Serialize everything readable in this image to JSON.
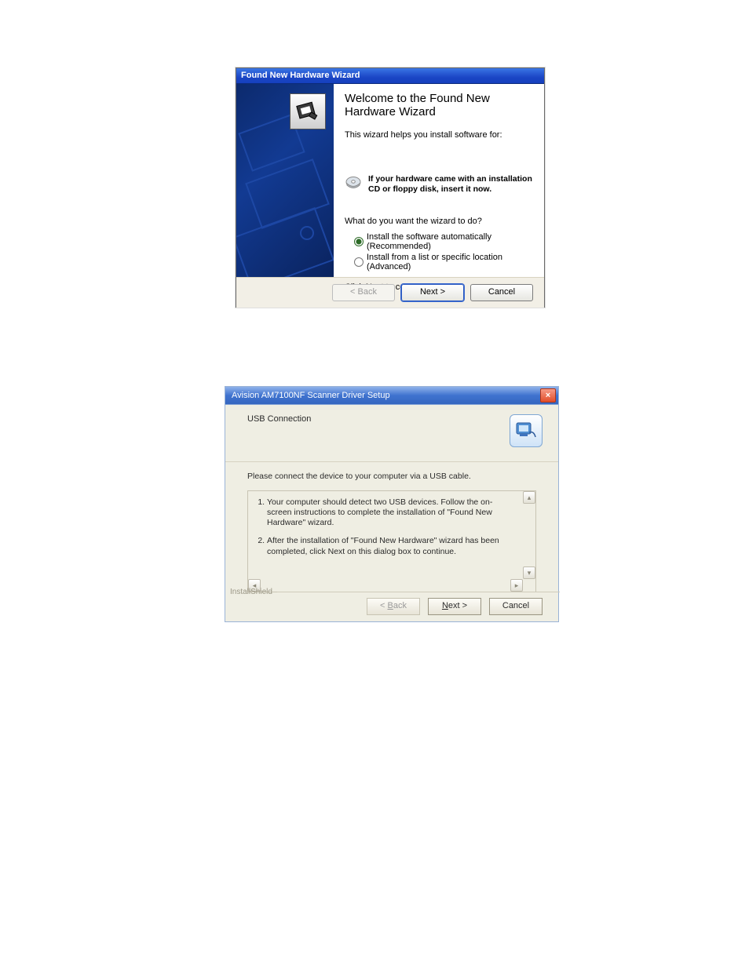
{
  "dlg1": {
    "title": "Found New Hardware Wizard",
    "heading": "Welcome to the Found New Hardware Wizard",
    "sub": "This wizard helps you install software for:",
    "cd_text": "If your hardware came with an installation CD or floppy disk, insert it now.",
    "question": "What do you want the wizard to do?",
    "opt1": "Install the software automatically (Recommended)",
    "opt2": "Install from a list or specific location (Advanced)",
    "continue": "Click Next to continue.",
    "btn_back": "< Back",
    "btn_next": "Next >",
    "btn_cancel": "Cancel"
  },
  "dlg2": {
    "title": "Avision AM7100NF Scanner Driver Setup",
    "header": "USB Connection",
    "msg": "Please connect the device to your computer via a USB cable.",
    "item1": "Your computer should detect two USB devices.  Follow the on-screen instructions to complete the installation of \"Found New Hardware\" wizard.",
    "item2": "After the installation of \"Found New Hardware\" wizard has been completed, click Next on this dialog box to continue.",
    "brand": "InstallShield",
    "btn_back_html": "< <span class='u'>B</span>ack",
    "btn_next_html": "<span class='u'>N</span>ext >",
    "btn_cancel": "Cancel",
    "close_glyph": "×"
  }
}
